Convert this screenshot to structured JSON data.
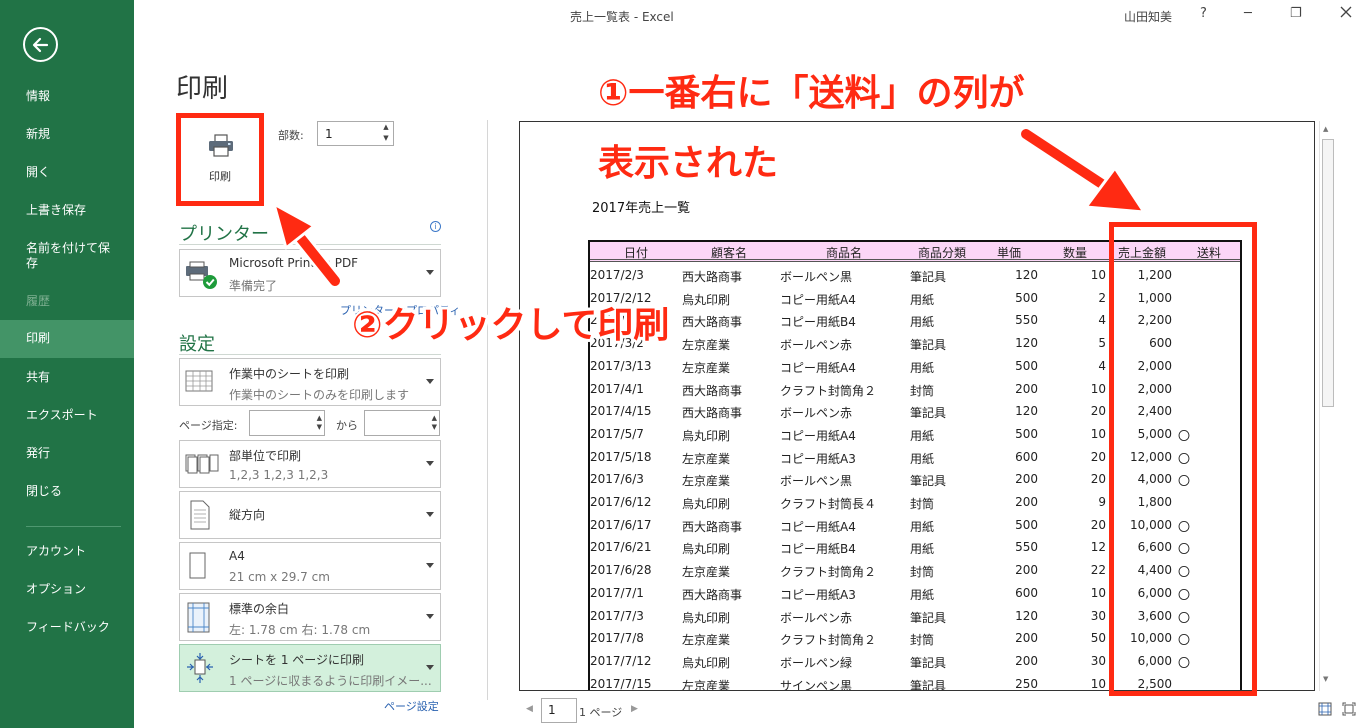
{
  "window": {
    "title": "売上一覧表 - Excel",
    "user": "山田知美",
    "help": "?",
    "minimize": "─",
    "restore": "❐"
  },
  "sidebar": {
    "items": [
      {
        "label": "情報"
      },
      {
        "label": "新規"
      },
      {
        "label": "開く"
      },
      {
        "label": "上書き保存"
      },
      {
        "label": "名前を付けて保存"
      },
      {
        "label": "履歴"
      },
      {
        "label": "印刷"
      },
      {
        "label": "共有"
      },
      {
        "label": "エクスポート"
      },
      {
        "label": "発行"
      },
      {
        "label": "閉じる"
      },
      {
        "label": "アカウント"
      },
      {
        "label": "オプション"
      },
      {
        "label": "フィードバック"
      }
    ]
  },
  "print": {
    "title": "印刷",
    "button_label": "印刷",
    "copies_label": "部数:",
    "copies_value": "1",
    "printer_section": "プリンター",
    "printer_name": "Microsoft Print to PDF",
    "printer_status": "準備完了",
    "printer_properties": "プリンターのプロパティ",
    "settings_section": "設定",
    "sheet_scope": "作業中のシートを印刷",
    "sheet_scope_desc": "作業中のシートのみを印刷します",
    "pages_label": "ページ指定:",
    "pages_to_label": "から",
    "collate": "部単位で印刷",
    "collate_desc": "1,2,3    1,2,3    1,2,3",
    "orientation": "縦方向",
    "paper": "A4",
    "paper_size": "21 cm x 29.7 cm",
    "margins": "標準の余白",
    "margins_desc": "左:  1.78 cm    右:  1.78 cm",
    "scaling": "シートを 1 ページに印刷",
    "scaling_desc": "1 ページに収まるように印刷イメー...",
    "page_setup": "ページ設定"
  },
  "preview": {
    "sheet_title": "2017年売上一覧",
    "headers": [
      "日付",
      "顧客名",
      "商品名",
      "商品分類",
      "単価",
      "数量",
      "売上金額",
      "送料"
    ],
    "rows": [
      [
        "2017/2/3",
        "西大路商事",
        "ボールペン黒",
        "筆記具",
        "120",
        "10",
        "1,200",
        ""
      ],
      [
        "2017/2/12",
        "烏丸印刷",
        "コピー用紙A4",
        "用紙",
        "500",
        "2",
        "1,000",
        ""
      ],
      [
        "2017/2/18",
        "西大路商事",
        "コピー用紙B4",
        "用紙",
        "550",
        "4",
        "2,200",
        ""
      ],
      [
        "2017/3/2",
        "左京産業",
        "ボールペン赤",
        "筆記具",
        "120",
        "5",
        "600",
        ""
      ],
      [
        "2017/3/13",
        "左京産業",
        "コピー用紙A4",
        "用紙",
        "500",
        "4",
        "2,000",
        ""
      ],
      [
        "2017/4/1",
        "西大路商事",
        "クラフト封筒角２",
        "封筒",
        "200",
        "10",
        "2,000",
        ""
      ],
      [
        "2017/4/15",
        "西大路商事",
        "ボールペン赤",
        "筆記具",
        "120",
        "20",
        "2,400",
        ""
      ],
      [
        "2017/5/7",
        "烏丸印刷",
        "コピー用紙A4",
        "用紙",
        "500",
        "10",
        "5,000",
        "〇"
      ],
      [
        "2017/5/18",
        "左京産業",
        "コピー用紙A3",
        "用紙",
        "600",
        "20",
        "12,000",
        "〇"
      ],
      [
        "2017/6/3",
        "左京産業",
        "ボールペン黒",
        "筆記具",
        "200",
        "20",
        "4,000",
        "〇"
      ],
      [
        "2017/6/12",
        "烏丸印刷",
        "クラフト封筒長４",
        "封筒",
        "200",
        "9",
        "1,800",
        ""
      ],
      [
        "2017/6/17",
        "西大路商事",
        "コピー用紙A4",
        "用紙",
        "500",
        "20",
        "10,000",
        "〇"
      ],
      [
        "2017/6/21",
        "烏丸印刷",
        "コピー用紙B4",
        "用紙",
        "550",
        "12",
        "6,600",
        "〇"
      ],
      [
        "2017/6/28",
        "左京産業",
        "クラフト封筒角２",
        "封筒",
        "200",
        "22",
        "4,400",
        "〇"
      ],
      [
        "2017/7/1",
        "西大路商事",
        "コピー用紙A3",
        "用紙",
        "600",
        "10",
        "6,000",
        "〇"
      ],
      [
        "2017/7/3",
        "烏丸印刷",
        "ボールペン赤",
        "筆記具",
        "120",
        "30",
        "3,600",
        "〇"
      ],
      [
        "2017/7/8",
        "左京産業",
        "クラフト封筒角２",
        "封筒",
        "200",
        "50",
        "10,000",
        "〇"
      ],
      [
        "2017/7/12",
        "烏丸印刷",
        "ボールペン緑",
        "筆記具",
        "200",
        "30",
        "6,000",
        "〇"
      ],
      [
        "2017/7/15",
        "左京産業",
        "サインペン黒",
        "筆記具",
        "250",
        "10",
        "2,500",
        ""
      ]
    ],
    "current_page": "1",
    "page_count": "1 ページ"
  },
  "annotations": {
    "note1_line1": "①一番右に「送料」の列が",
    "note1_line2": "表示された",
    "note2": "②クリックして印刷"
  },
  "colors": {
    "backstage_green": "#217346",
    "active_item": "#439467",
    "annotation_red": "#ff2a12",
    "header_pink": "#fbd6f7"
  }
}
